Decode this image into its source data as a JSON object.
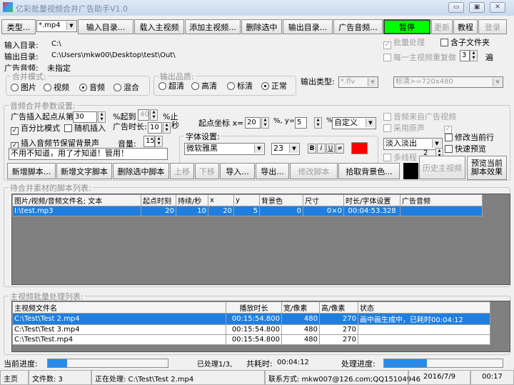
{
  "window": {
    "title": "亿彩批量视频合并广告助手V1.0"
  },
  "toolbar": {
    "type_label": "类型...",
    "type_value": "*.mp4",
    "input_dir": "输入目录...",
    "load_main": "载入主视频",
    "add_main": "添加主视频...",
    "delete_selected": "删除选中",
    "output_dir": "输出目录...",
    "ad_audio": "广告音频...",
    "pause": "暂停",
    "update": "更新",
    "tutorial": "教程",
    "login": "登录",
    "pause_color": "#00ff00"
  },
  "info": {
    "input_dir_label": "输入目录:",
    "input_dir_value": "C:\\",
    "output_dir_label": "输出目录:",
    "output_dir_value": "C:\\Users\\mkw00\\Desktop\\test\\Out\\",
    "ad_audio_label": "广告音频:",
    "ad_audio_value": "未指定"
  },
  "options": {
    "batch": "批量处理",
    "subfolder": "含子文件夹",
    "repeat": "每一主视频重复做",
    "repeat_count": "3",
    "repeat_unit": "遍"
  },
  "merge_mode": {
    "title": "合并模式:",
    "items": [
      "图片",
      "视频",
      "音频",
      "混合"
    ],
    "selected": 2
  },
  "quality": {
    "title": "输出品质:",
    "items": [
      "超清",
      "高清",
      "标清",
      "正常"
    ],
    "selected": 3
  },
  "output_type": {
    "label": "输出类型:",
    "format": "*.flv",
    "resolution": "标清>=720x480"
  },
  "params": {
    "title": "音频合并参数设置:",
    "insert_start_label": "广告插入起点从第",
    "insert_start": "30",
    "to_label": "%起到",
    "to_value": "40",
    "stop_label": "%止",
    "percent_mode": "百分比模式",
    "random_insert": "随机插入",
    "ad_duration_label": "广告时长:",
    "ad_duration": "10",
    "sec_label": "秒",
    "coord_label": "起点坐标 x=",
    "x_value": "20",
    "y_label": "%, y=",
    "y_value": "5",
    "pct": "%",
    "position_preset": "自定义",
    "audio_from_ad": "音频来自广告视频",
    "use_original": "采用原声",
    "keep_bg": "插入音频节保留背景声",
    "volume_label": "音量:",
    "volume": "15",
    "text_value": "不用不知道，用了才知道！管用！",
    "font_group": "字体设置:",
    "font_name": "微软雅黑",
    "font_size": "23",
    "bold": "B",
    "italic": "I",
    "underline": "U",
    "strike": "≠",
    "font_color": "#ff0000",
    "transition": "淡入淡出",
    "modify_row": "修改当前行",
    "quick_preview": "快速预览",
    "multithread": "多线程",
    "threads": "2",
    "bg_color": "#000000"
  },
  "script_buttons": {
    "new_script": "新增脚本...",
    "new_text": "新增文字脚本",
    "delete_script": "删除选中脚本",
    "move_up": "上移",
    "move_down": "下移",
    "import": "导入...",
    "export": "导出...",
    "edit": "修改脚本",
    "pick_bg": "拾取背景色...",
    "history": "历史主视频",
    "preview": "预览当前脚本效果"
  },
  "script_list": {
    "title": "待合并素材的脚本列表:",
    "columns": [
      "图片/视频/音频文件名; 文本",
      "起点时刻",
      "持续/秒",
      "x",
      "y",
      "背景色",
      "尺寸",
      "时长/字体设置",
      "广告音频"
    ],
    "rows": [
      [
        "I:\\test.mp3",
        "20",
        "10",
        "20",
        "5",
        "0",
        "0×0",
        "00:04:53.328",
        ""
      ]
    ]
  },
  "main_list": {
    "title": "主视频批量处理列表:",
    "columns": [
      "主视频文件名",
      "播放时长",
      "宽/像素",
      "高/像素",
      "状态"
    ],
    "rows": [
      [
        "C:\\Test\\Test 2.mp4",
        "00:15:54.800",
        "480",
        "270",
        "画中画生成中，已耗时00:04:12"
      ],
      [
        "C:\\Test\\Test 3.mp4",
        "00:15:54.800",
        "480",
        "270",
        ""
      ],
      [
        "C:\\Test\\Test.mp4",
        "00:15:54.800",
        "480",
        "270",
        ""
      ]
    ]
  },
  "progress": {
    "current_label": "当前进度:",
    "current_fraction": 0.16,
    "processed": "已处理1/3,",
    "elapsed_label": "共耗时:",
    "elapsed": "00:04:12",
    "total_label": "处理进度:",
    "total_fraction": 0.36
  },
  "status": {
    "home": "主页",
    "file_count": "文件数: 3",
    "processing": "正在处理: C:\\Test\\Test 2.mp4",
    "contact": "联系方式: mkw007@126.com;QQ15104946",
    "date": "2016/7/9",
    "time": "00:17"
  }
}
